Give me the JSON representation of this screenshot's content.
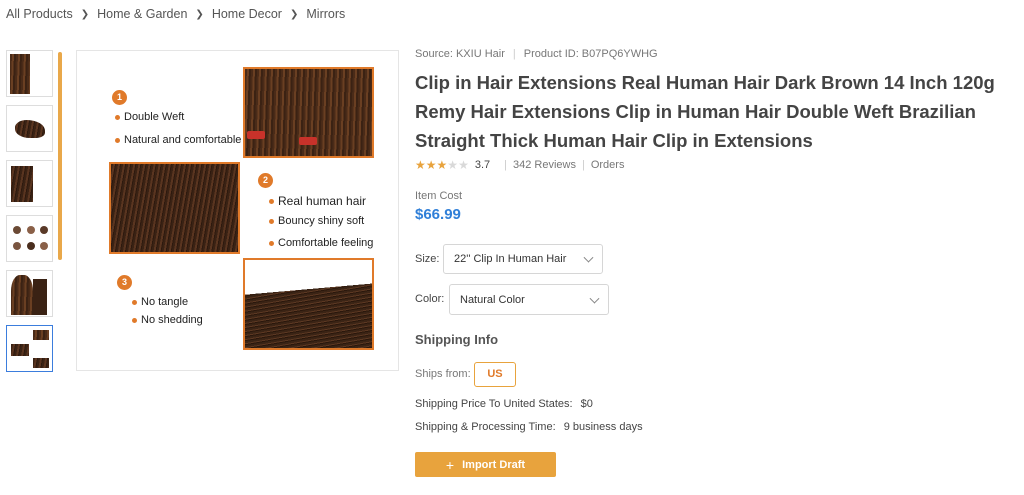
{
  "breadcrumb": [
    "All Products",
    "Home & Garden",
    "Home Decor",
    "Mirrors"
  ],
  "image_panel": {
    "badges": [
      "1",
      "2",
      "3"
    ],
    "section1": [
      "Double Weft",
      "Natural and comfortable"
    ],
    "section2": [
      "Real human hair",
      "Bouncy shiny soft",
      "Comfortable feeling"
    ],
    "section3": [
      "No tangle",
      "No shedding"
    ]
  },
  "product": {
    "source": "Source: KXIU Hair",
    "product_id": "Product ID: B07PQ6YWHG",
    "title": "Clip in Hair Extensions Real Human Hair Dark Brown 14 Inch 120g Remy Hair Extensions Clip in Human Hair Double Weft Brazilian Straight Thick Human Hair Clip in Extensions",
    "rating": 3.7,
    "rating_text": "3.7",
    "reviews": "342 Reviews",
    "orders": "Orders",
    "item_cost_label": "Item Cost",
    "price": "$66.99"
  },
  "options": {
    "size_label": "Size:",
    "size_value": "22'' Clip In Human Hair",
    "color_label": "Color:",
    "color_value": "Natural Color"
  },
  "shipping": {
    "heading": "Shipping Info",
    "ships_from_label": "Ships from:",
    "ships_from_value": "US",
    "price_label": "Shipping Price To United States:",
    "price_value": "$0",
    "time_label": "Shipping & Processing Time:",
    "time_value": "9 business days"
  },
  "actions": {
    "import_label": "Import Draft"
  },
  "colors": {
    "accent": "#e8a33d",
    "price": "#2f7fd8",
    "badge": "#e07a2a"
  }
}
